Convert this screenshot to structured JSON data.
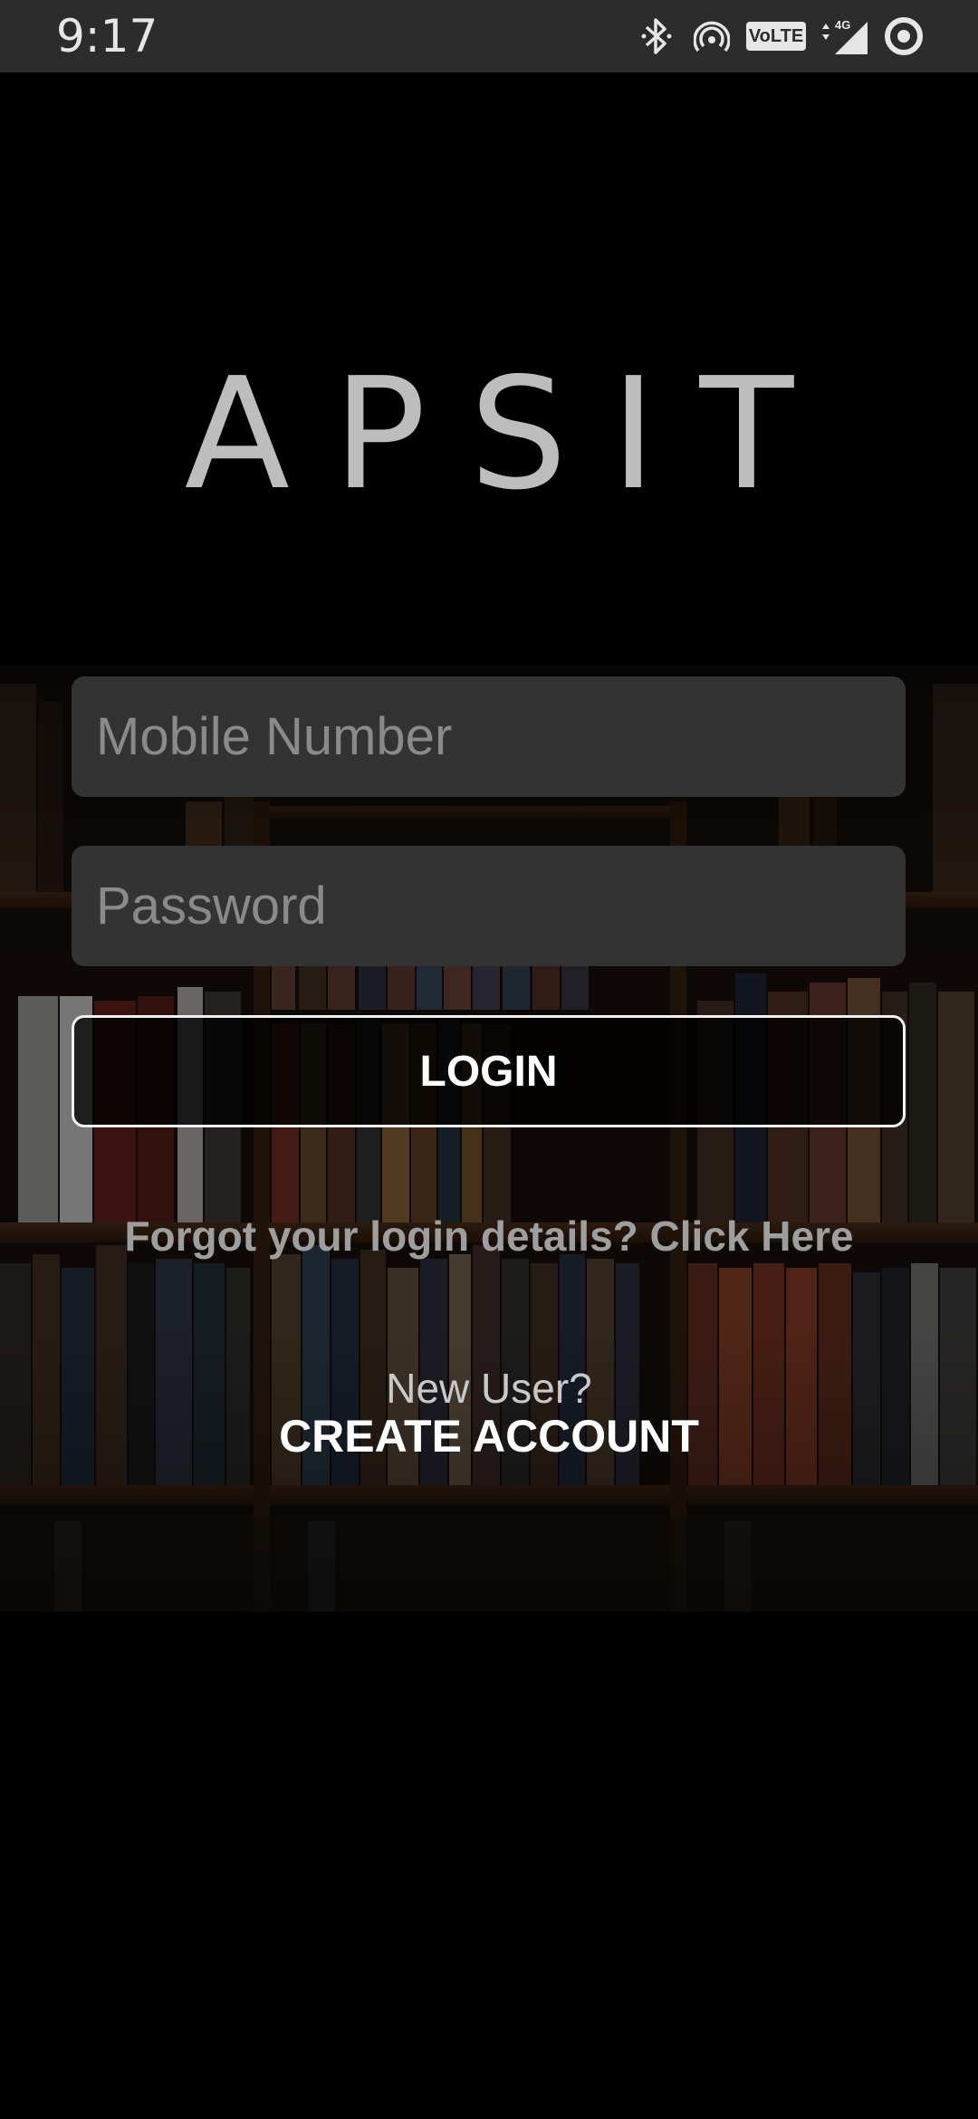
{
  "status_bar": {
    "time": "9:17",
    "icons": [
      "bluetooth-icon",
      "hotspot-icon",
      "volte-icon",
      "4g-signal-icon",
      "battery-saver-icon"
    ],
    "volte_label": "VoLTE",
    "network_label": "4G"
  },
  "app": {
    "title": "APSIT"
  },
  "form": {
    "mobile_placeholder": "Mobile Number",
    "password_placeholder": "Password",
    "login_label": "LOGIN",
    "forgot_text": "Forgot your login details? Click Here",
    "new_user_label": "New User?",
    "create_account_label": "CREATE ACCOUNT"
  },
  "colors": {
    "background": "#000000",
    "status_bar": "#2c2c2c",
    "field_bg": "#333333",
    "logo": "#bdbdbd",
    "link_muted": "#9e9e9e"
  }
}
